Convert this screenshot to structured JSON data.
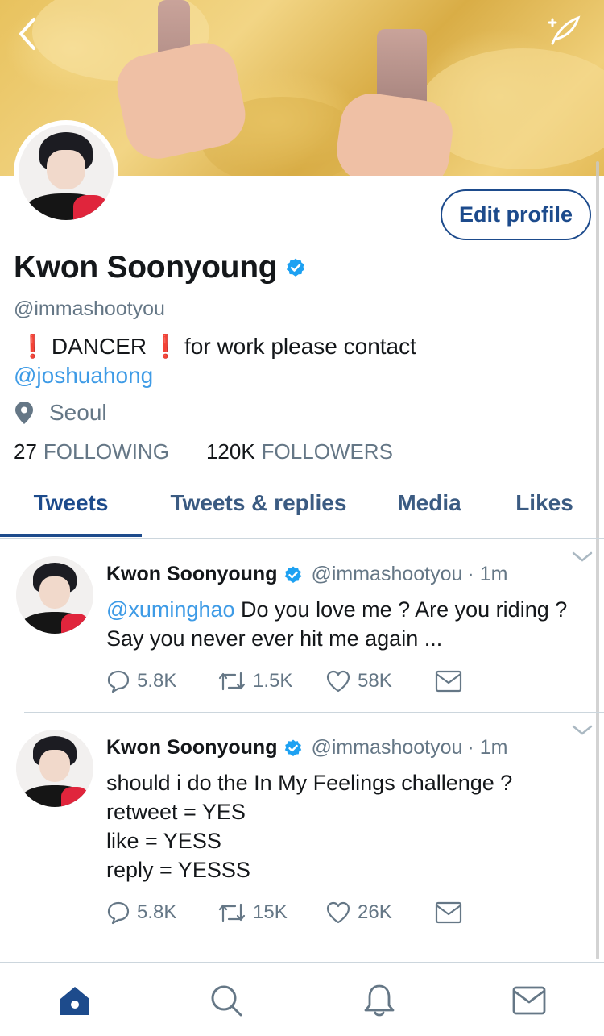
{
  "profile": {
    "name": "Kwon Soonyoung",
    "handle": "@immashootyou",
    "bio_prefix_icon": "❗",
    "bio_word": "DANCER",
    "bio_suffix": "for work please contact",
    "bio_mention": "@joshuahong",
    "location": "Seoul",
    "following_count": "27",
    "following_label": "FOLLOWING",
    "followers_count": "120K",
    "followers_label": "FOLLOWERS",
    "edit_label": "Edit profile"
  },
  "tabs": [
    {
      "label": "Tweets",
      "active": true
    },
    {
      "label": "Tweets & replies",
      "active": false
    },
    {
      "label": "Media",
      "active": false
    },
    {
      "label": "Likes",
      "active": false
    }
  ],
  "tweets": [
    {
      "name": "Kwon Soonyoung",
      "handle": "@immashootyou",
      "time": "· 1m",
      "mention": "@xuminghao",
      "text": "Do you love me ? Are you riding ? Say you never ever hit me again ...",
      "replies": "5.8K",
      "retweets": "1.5K",
      "likes": "58K"
    },
    {
      "name": "Kwon Soonyoung",
      "handle": "@immashootyou",
      "time": "· 1m",
      "line1": "should i do the In My Feelings challenge ?",
      "line2": "retweet = YES",
      "line3": "like = YESS",
      "line4": "reply = YESSS",
      "replies": "5.8K",
      "retweets": "15K",
      "likes": "26K"
    }
  ],
  "icons": {
    "back": "chevron-left-icon",
    "compose": "compose-feather-icon",
    "verified": "verified-badge-icon",
    "location": "location-pin-icon",
    "reply": "reply-bubble-icon",
    "retweet": "retweet-icon",
    "like": "heart-icon",
    "dm": "envelope-icon",
    "home": "home-icon",
    "search": "search-icon",
    "notifications": "bell-icon",
    "messages": "mail-icon"
  },
  "colors": {
    "accent": "#1d4b8c",
    "link": "#3e9be6",
    "verified": "#1da1f2",
    "muted": "#657786",
    "alert": "#e0252c"
  }
}
